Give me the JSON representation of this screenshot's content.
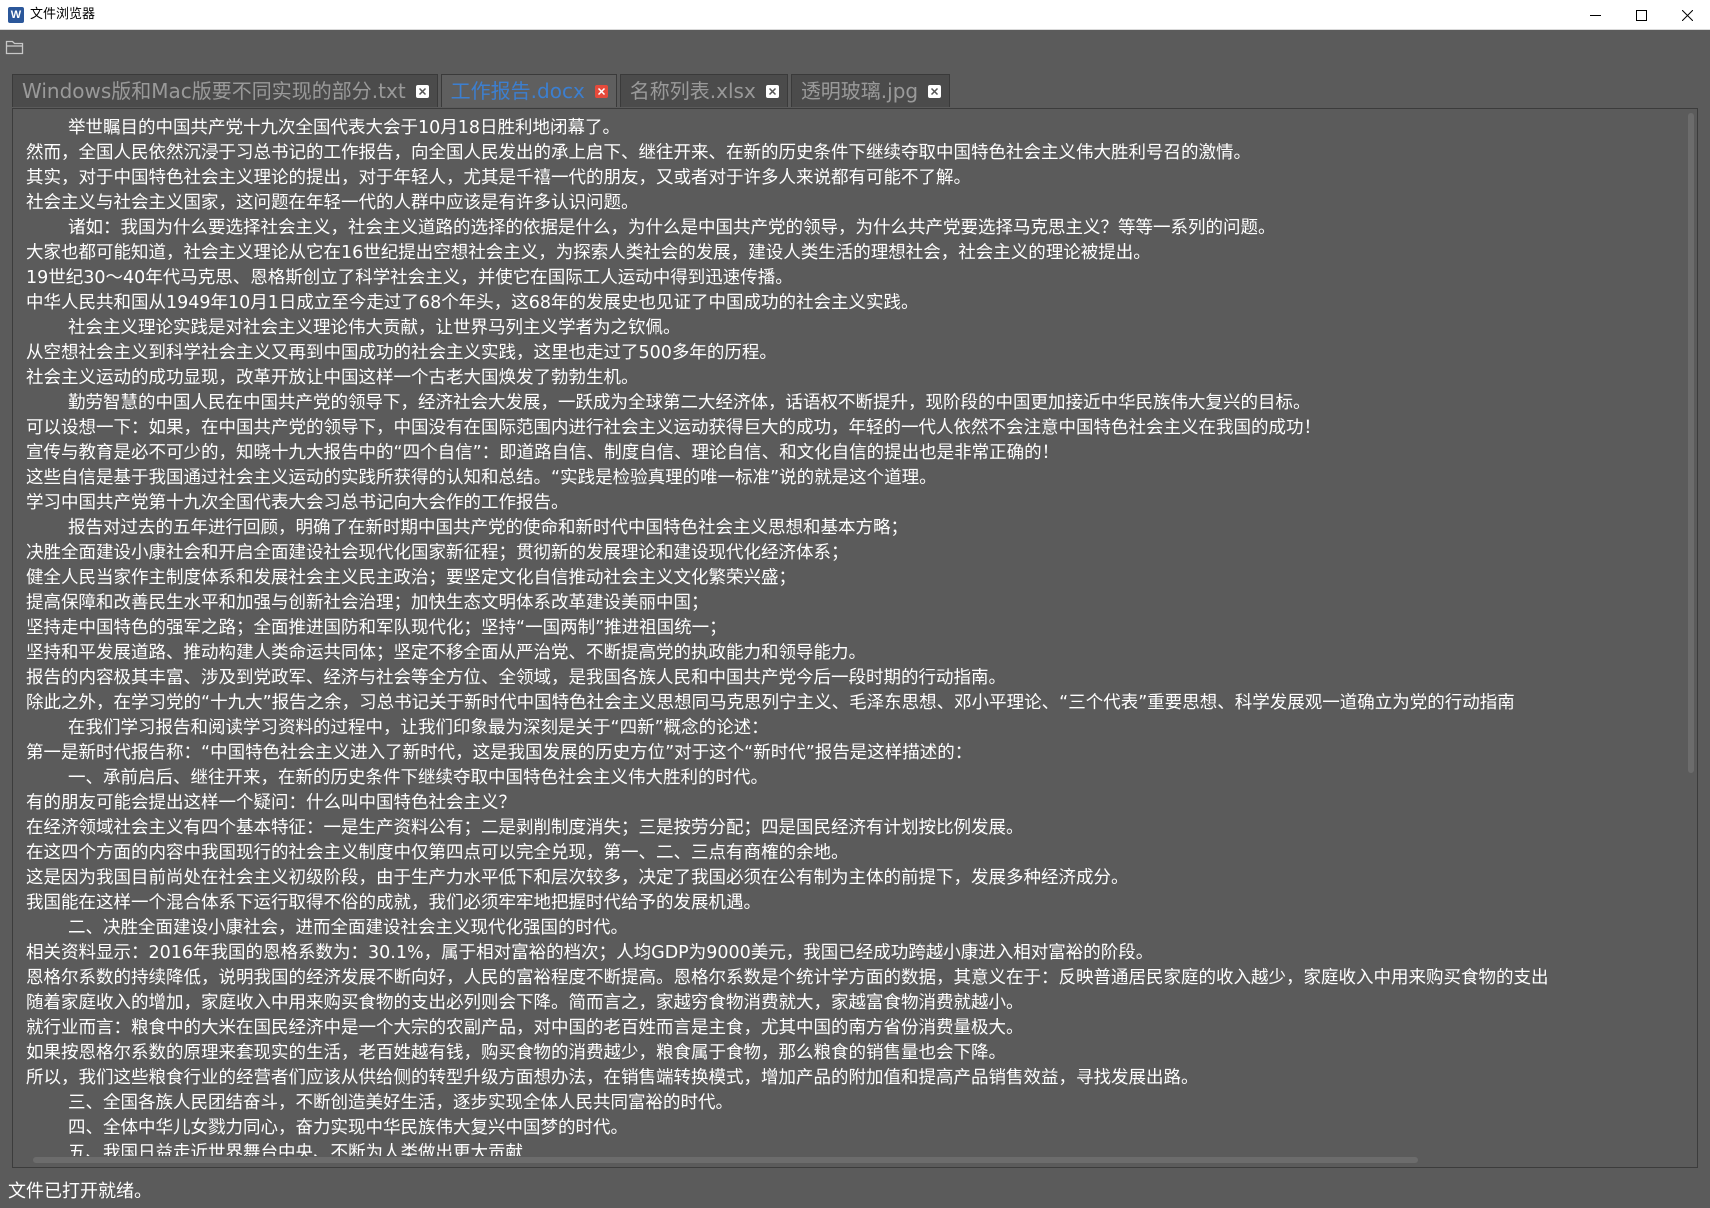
{
  "window": {
    "title": "文件浏览器",
    "app_icon_letter": "W",
    "controls": [
      "minimize",
      "maximize",
      "close"
    ]
  },
  "toolbar": {
    "open_icon": "folder-open-icon"
  },
  "tabs": [
    {
      "label": "Windows版和Mac版要不同实现的部分.txt",
      "active": false
    },
    {
      "label": "工作报告.docx",
      "active": true
    },
    {
      "label": "名称列表.xlsx",
      "active": false
    },
    {
      "label": "透明玻璃.jpg",
      "active": false
    }
  ],
  "document": {
    "lines": [
      {
        "text": "举世瞩目的中国共产党十九次全国代表大会于10月18日胜利地闭幕了。",
        "indent": true
      },
      {
        "text": "然而，全国人民依然沉浸于习总书记的工作报告，向全国人民发出的承上启下、继往开来、在新的历史条件下继续夺取中国特色社会主义伟大胜利号召的激情。",
        "indent": false
      },
      {
        "text": "其实，对于中国特色社会主义理论的提出，对于年轻人，尤其是千禧一代的朋友，又或者对于许多人来说都有可能不了解。",
        "indent": false
      },
      {
        "text": "社会主义与社会主义国家，这问题在年轻一代的人群中应该是有许多认识问题。",
        "indent": false
      },
      {
        "text": "诸如：我国为什么要选择社会主义，社会主义道路的选择的依据是什么，为什么是中国共产党的领导，为什么共产党要选择马克思主义？等等一系列的问题。",
        "indent": true
      },
      {
        "text": "大家也都可能知道，社会主义理论从它在16世纪提出空想社会主义，为探索人类社会的发展，建设人类生活的理想社会，社会主义的理论被提出。",
        "indent": false
      },
      {
        "text": "19世纪30～40年代马克思、恩格斯创立了科学社会主义，并使它在国际工人运动中得到迅速传播。",
        "indent": false
      },
      {
        "text": "中华人民共和国从1949年10月1日成立至今走过了68个年头，这68年的发展史也见证了中国成功的社会主义实践。",
        "indent": false
      },
      {
        "text": "社会主义理论实践是对社会主义理论伟大贡献，让世界马列主义学者为之钦佩。",
        "indent": true
      },
      {
        "text": "从空想社会主义到科学社会主义又再到中国成功的社会主义实践，这里也走过了500多年的历程。",
        "indent": false
      },
      {
        "text": "社会主义运动的成功显现，改革开放让中国这样一个古老大国焕发了勃勃生机。",
        "indent": false
      },
      {
        "text": "勤劳智慧的中国人民在中国共产党的领导下，经济社会大发展，一跃成为全球第二大经济体，话语权不断提升，现阶段的中国更加接近中华民族伟大复兴的目标。",
        "indent": true
      },
      {
        "text": "可以设想一下：如果，在中国共产党的领导下，中国没有在国际范围内进行社会主义运动获得巨大的成功，年轻的一代人依然不会注意中国特色社会主义在我国的成功！",
        "indent": false
      },
      {
        "text": "宣传与教育是必不可少的，知晓十九大报告中的“四个自信”：即道路自信、制度自信、理论自信、和文化自信的提出也是非常正确的！",
        "indent": false
      },
      {
        "text": "这些自信是基于我国通过社会主义运动的实践所获得的认知和总结。“实践是检验真理的唯一标准”说的就是这个道理。",
        "indent": false
      },
      {
        "text": "学习中国共产党第十九次全国代表大会习总书记向大会作的工作报告。",
        "indent": false
      },
      {
        "text": "报告对过去的五年进行回顾，明确了在新时期中国共产党的使命和新时代中国特色社会主义思想和基本方略；",
        "indent": true
      },
      {
        "text": "决胜全面建设小康社会和开启全面建设社会现代化国家新征程；贯彻新的发展理论和建设现代化经济体系；",
        "indent": false
      },
      {
        "text": "健全人民当家作主制度体系和发展社会主义民主政治；要坚定文化自信推动社会主义文化繁荣兴盛；",
        "indent": false
      },
      {
        "text": "提高保障和改善民生水平和加强与创新社会治理；加快生态文明体系改革建设美丽中国；",
        "indent": false
      },
      {
        "text": "坚持走中国特色的强军之路；全面推进国防和军队现代化；坚持“一国两制”推进祖国统一；",
        "indent": false
      },
      {
        "text": "坚持和平发展道路、推动构建人类命运共同体；坚定不移全面从严治党、不断提高党的执政能力和领导能力。",
        "indent": false
      },
      {
        "text": "报告的内容极其丰富、涉及到党政军、经济与社会等全方位、全领域，是我国各族人民和中国共产党今后一段时期的行动指南。",
        "indent": false
      },
      {
        "text": "除此之外，在学习党的“十九大”报告之余，习总书记关于新时代中国特色社会主义思想同马克思列宁主义、毛泽东思想、邓小平理论、“三个代表”重要思想、科学发展观一道确立为党的行动指南",
        "indent": false
      },
      {
        "text": "在我们学习报告和阅读学习资料的过程中，让我们印象最为深刻是关于“四新”概念的论述：",
        "indent": true
      },
      {
        "text": "第一是新时代报告称：“中国特色社会主义进入了新时代，这是我国发展的历史方位”对于这个“新时代”报告是这样描述的：",
        "indent": false
      },
      {
        "text": "一、承前启后、继往开来，在新的历史条件下继续夺取中国特色社会主义伟大胜利的时代。",
        "indent": true
      },
      {
        "text": "有的朋友可能会提出这样一个疑问：什么叫中国特色社会主义？",
        "indent": false
      },
      {
        "text": "在经济领域社会主义有四个基本特征：一是生产资料公有；二是剥削制度消失；三是按劳分配；四是国民经济有计划按比例发展。",
        "indent": false
      },
      {
        "text": "在这四个方面的内容中我国现行的社会主义制度中仅第四点可以完全兑现，第一、二、三点有商榷的余地。",
        "indent": false
      },
      {
        "text": "这是因为我国目前尚处在社会主义初级阶段，由于生产力水平低下和层次较多，决定了我国必须在公有制为主体的前提下，发展多种经济成分。",
        "indent": false
      },
      {
        "text": "我国能在这样一个混合体系下运行取得不俗的成就，我们必须牢牢地把握时代给予的发展机遇。",
        "indent": false
      },
      {
        "text": "二、决胜全面建设小康社会，进而全面建设社会主义现代化强国的时代。",
        "indent": true
      },
      {
        "text": "相关资料显示：2016年我国的恩格系数为：30.1%，属于相对富裕的档次；人均GDP为9000美元，我国已经成功跨越小康进入相对富裕的阶段。",
        "indent": false
      },
      {
        "text": "恩格尔系数的持续降低，说明我国的经济发展不断向好，人民的富裕程度不断提高。恩格尔系数是个统计学方面的数据，其意义在于：反映普通居民家庭的收入越少，家庭收入中用来购买食物的支出",
        "indent": false
      },
      {
        "text": "随着家庭收入的增加，家庭收入中用来购买食物的支出必列则会下降。简而言之，家越穷食物消费就大，家越富食物消费就越小。",
        "indent": false
      },
      {
        "text": "就行业而言：粮食中的大米在国民经济中是一个大宗的农副产品，对中国的老百姓而言是主食，尤其中国的南方省份消费量极大。",
        "indent": false
      },
      {
        "text": "如果按恩格尔系数的原理来套现实的生活，老百姓越有钱，购买食物的消费越少，粮食属于食物，那么粮食的销售量也会下降。",
        "indent": false
      },
      {
        "text": "所以，我们这些粮食行业的经营者们应该从供给侧的转型升级方面想办法，在销售端转换模式，增加产品的附加值和提高产品销售效益，寻找发展出路。",
        "indent": false
      },
      {
        "text": "三、全国各族人民团结奋斗，不断创造美好生活，逐步实现全体人民共同富裕的时代。",
        "indent": true
      },
      {
        "text": "四、全体中华儿女戮力同心，奋力实现中华民族伟大复兴中国梦的时代。",
        "indent": true
      },
      {
        "text": "五、我国日益走近世界舞台中央、不断为人类做出更大贡献",
        "indent": true
      }
    ]
  },
  "status": {
    "text": "文件已打开就绪。"
  },
  "colors": {
    "background": "#5b5b5b",
    "active_tab_text": "#3c7fd0",
    "inactive_tab_text": "#9a9a9a",
    "active_close": "#e64a3b",
    "text": "#ffffff"
  }
}
